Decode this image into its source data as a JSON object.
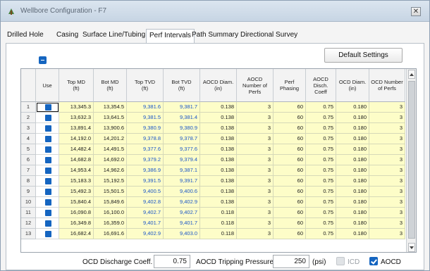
{
  "window": {
    "title": "Wellbore Configuration - F7",
    "close_glyph": "✕"
  },
  "tabs": [
    {
      "label": "Drilled Hole",
      "active": false
    },
    {
      "label": "Casing",
      "active": false
    },
    {
      "label": "Surface Line/Tubing",
      "active": false
    },
    {
      "label": "Perf Intervals",
      "active": true
    },
    {
      "label": "Path Summary",
      "active": false
    },
    {
      "label": "Directional Survey",
      "active": false
    }
  ],
  "toolbar": {
    "default_settings_label": "Default Settings"
  },
  "table": {
    "headers": [
      "",
      "Use",
      "Top MD\n(ft)",
      "Bot MD\n(ft)",
      "Top TVD\n(ft)",
      "Bot TVD\n(ft)",
      "AOCD Diam.\n(in)",
      "AOCD\nNumber of\nPerfs",
      "Perf\nPhasing",
      "AOCD\nDisch.\nCoeff",
      "OCD Diam.\n(in)",
      "OCD Number\nof Perfs"
    ],
    "rows": [
      {
        "n": "1",
        "use": true,
        "top_md": "13,345.3",
        "bot_md": "13,354.5",
        "top_tvd": "9,381.6",
        "bot_tvd": "9,381.7",
        "aocd_diam": "0.138",
        "aocd_perfs": "3",
        "phasing": "60",
        "coeff": "0.75",
        "ocd_diam": "0.180",
        "ocd_perfs": "3"
      },
      {
        "n": "2",
        "use": true,
        "top_md": "13,632.3",
        "bot_md": "13,641.5",
        "top_tvd": "9,381.5",
        "bot_tvd": "9,381.4",
        "aocd_diam": "0.138",
        "aocd_perfs": "3",
        "phasing": "60",
        "coeff": "0.75",
        "ocd_diam": "0.180",
        "ocd_perfs": "3"
      },
      {
        "n": "3",
        "use": true,
        "top_md": "13,891.4",
        "bot_md": "13,900.6",
        "top_tvd": "9,380.9",
        "bot_tvd": "9,380.9",
        "aocd_diam": "0.138",
        "aocd_perfs": "3",
        "phasing": "60",
        "coeff": "0.75",
        "ocd_diam": "0.180",
        "ocd_perfs": "3"
      },
      {
        "n": "4",
        "use": true,
        "top_md": "14,192.0",
        "bot_md": "14,201.2",
        "top_tvd": "9,378.8",
        "bot_tvd": "9,378.7",
        "aocd_diam": "0.138",
        "aocd_perfs": "3",
        "phasing": "60",
        "coeff": "0.75",
        "ocd_diam": "0.180",
        "ocd_perfs": "3"
      },
      {
        "n": "5",
        "use": true,
        "top_md": "14,482.4",
        "bot_md": "14,491.5",
        "top_tvd": "9,377.6",
        "bot_tvd": "9,377.6",
        "aocd_diam": "0.138",
        "aocd_perfs": "3",
        "phasing": "60",
        "coeff": "0.75",
        "ocd_diam": "0.180",
        "ocd_perfs": "3"
      },
      {
        "n": "6",
        "use": true,
        "top_md": "14,682.8",
        "bot_md": "14,692.0",
        "top_tvd": "9,379.2",
        "bot_tvd": "9,379.4",
        "aocd_diam": "0.138",
        "aocd_perfs": "3",
        "phasing": "60",
        "coeff": "0.75",
        "ocd_diam": "0.180",
        "ocd_perfs": "3"
      },
      {
        "n": "7",
        "use": true,
        "top_md": "14,953.4",
        "bot_md": "14,962.6",
        "top_tvd": "9,386.9",
        "bot_tvd": "9,387.1",
        "aocd_diam": "0.138",
        "aocd_perfs": "3",
        "phasing": "60",
        "coeff": "0.75",
        "ocd_diam": "0.180",
        "ocd_perfs": "3"
      },
      {
        "n": "8",
        "use": true,
        "top_md": "15,183.3",
        "bot_md": "15,192.5",
        "top_tvd": "9,391.5",
        "bot_tvd": "9,391.7",
        "aocd_diam": "0.138",
        "aocd_perfs": "3",
        "phasing": "60",
        "coeff": "0.75",
        "ocd_diam": "0.180",
        "ocd_perfs": "3"
      },
      {
        "n": "9",
        "use": true,
        "top_md": "15,492.3",
        "bot_md": "15,501.5",
        "top_tvd": "9,400.5",
        "bot_tvd": "9,400.6",
        "aocd_diam": "0.138",
        "aocd_perfs": "3",
        "phasing": "60",
        "coeff": "0.75",
        "ocd_diam": "0.180",
        "ocd_perfs": "3"
      },
      {
        "n": "10",
        "use": true,
        "top_md": "15,840.4",
        "bot_md": "15,849.6",
        "top_tvd": "9,402.8",
        "bot_tvd": "9,402.9",
        "aocd_diam": "0.138",
        "aocd_perfs": "3",
        "phasing": "60",
        "coeff": "0.75",
        "ocd_diam": "0.180",
        "ocd_perfs": "3"
      },
      {
        "n": "11",
        "use": true,
        "top_md": "16,090.8",
        "bot_md": "16,100.0",
        "top_tvd": "9,402.7",
        "bot_tvd": "9,402.7",
        "aocd_diam": "0.118",
        "aocd_perfs": "3",
        "phasing": "60",
        "coeff": "0.75",
        "ocd_diam": "0.180",
        "ocd_perfs": "3"
      },
      {
        "n": "12",
        "use": true,
        "top_md": "16,349.8",
        "bot_md": "16,359.0",
        "top_tvd": "9,401.7",
        "bot_tvd": "9,401.7",
        "aocd_diam": "0.118",
        "aocd_perfs": "3",
        "phasing": "60",
        "coeff": "0.75",
        "ocd_diam": "0.180",
        "ocd_perfs": "3"
      },
      {
        "n": "13",
        "use": true,
        "top_md": "16,682.4",
        "bot_md": "16,691.6",
        "top_tvd": "9,402.9",
        "bot_tvd": "9,403.0",
        "aocd_diam": "0.118",
        "aocd_perfs": "3",
        "phasing": "60",
        "coeff": "0.75",
        "ocd_diam": "0.180",
        "ocd_perfs": "3"
      }
    ]
  },
  "footer": {
    "ocd_coeff_label": "OCD Discharge Coeff.",
    "ocd_coeff_value": "0.75",
    "tripping_label": "AOCD Tripping Pressure",
    "tripping_value": "250",
    "tripping_unit": "(psi)",
    "icd_label": "ICD",
    "icd_checked": false,
    "aocd_label": "AOCD",
    "aocd_checked": true
  },
  "colors": {
    "accent": "#1565c0",
    "editable_cell": "#fdfdc8",
    "tvd_text": "#1b56c8"
  },
  "icons": {
    "app": "wellbore-app-icon",
    "close": "close-icon",
    "grid_toggle": "collapse-icon",
    "scroll_up": "scroll-up-arrow-icon",
    "scroll_down": "scroll-down-arrow-icon",
    "check": "checkbox-checked-icon"
  }
}
